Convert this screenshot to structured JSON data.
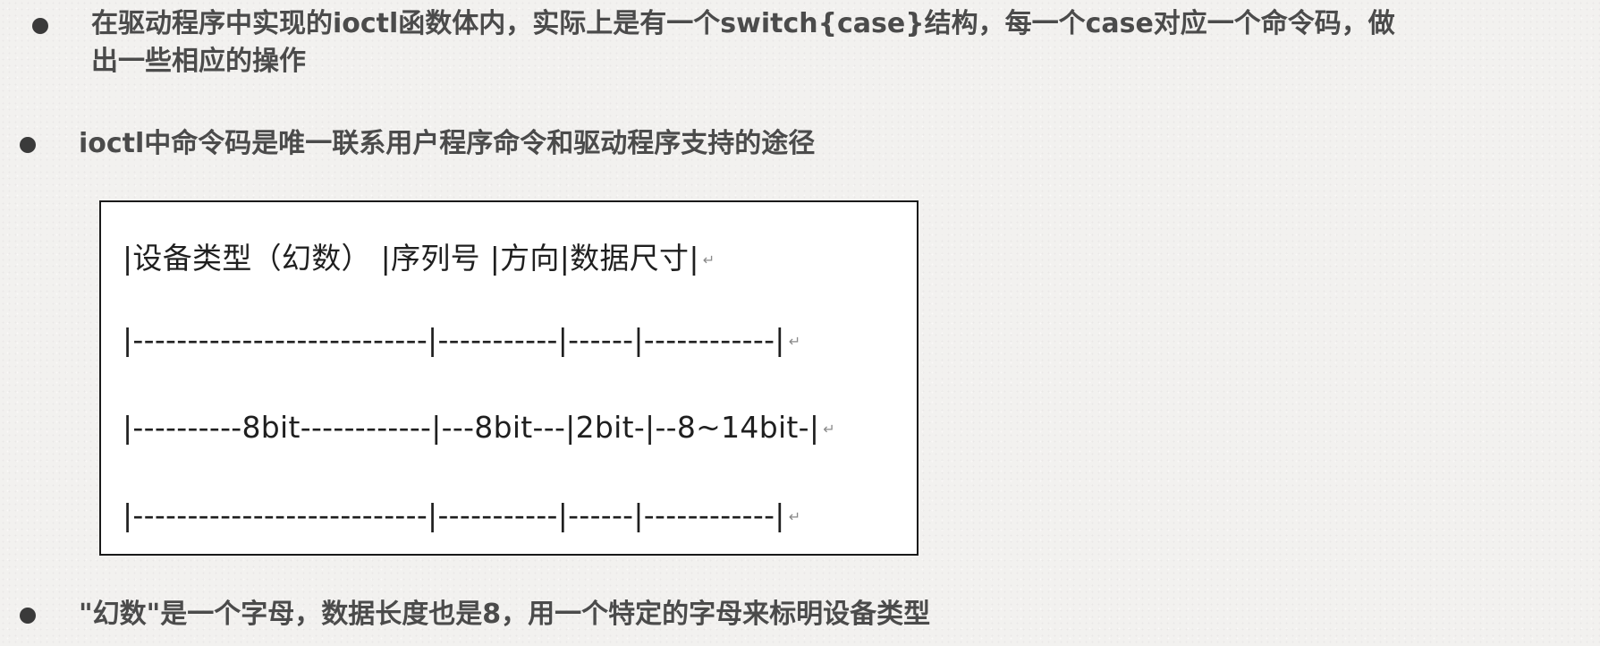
{
  "bullets": [
    {
      "line1": "在驱动程序中实现的ioctl函数体内，实际上是有一个switch{case}结构，每一个case对应一个命令码，做",
      "line2": "出一些相应的操作"
    },
    {
      "line1": "ioctl中命令码是唯一联系用户程序命令和驱动程序支持的途径"
    },
    {
      "line1": "\"幻数\"是一个字母，数据长度也是8，用一个特定的字母来标明设备类型"
    }
  ],
  "command_table": {
    "header": "|设备类型（幻数） |序列号 |方向|数据尺寸|",
    "separator_top": "|---------------------------|-----------|------|------------|",
    "bits": "|----------8bit------------|---8bit---|2bit-|--8~14bit-|",
    "separator_bottom": "|---------------------------|-----------|------|------------|",
    "return_mark": "↵"
  },
  "icons": {
    "bullet": "bullet-dot-icon",
    "return": "return-mark-icon"
  },
  "colors": {
    "text": "#4b4b4b",
    "bullet": "#3a3a3a",
    "background": "#f2f1ef",
    "box_border": "#1a1a1a"
  }
}
